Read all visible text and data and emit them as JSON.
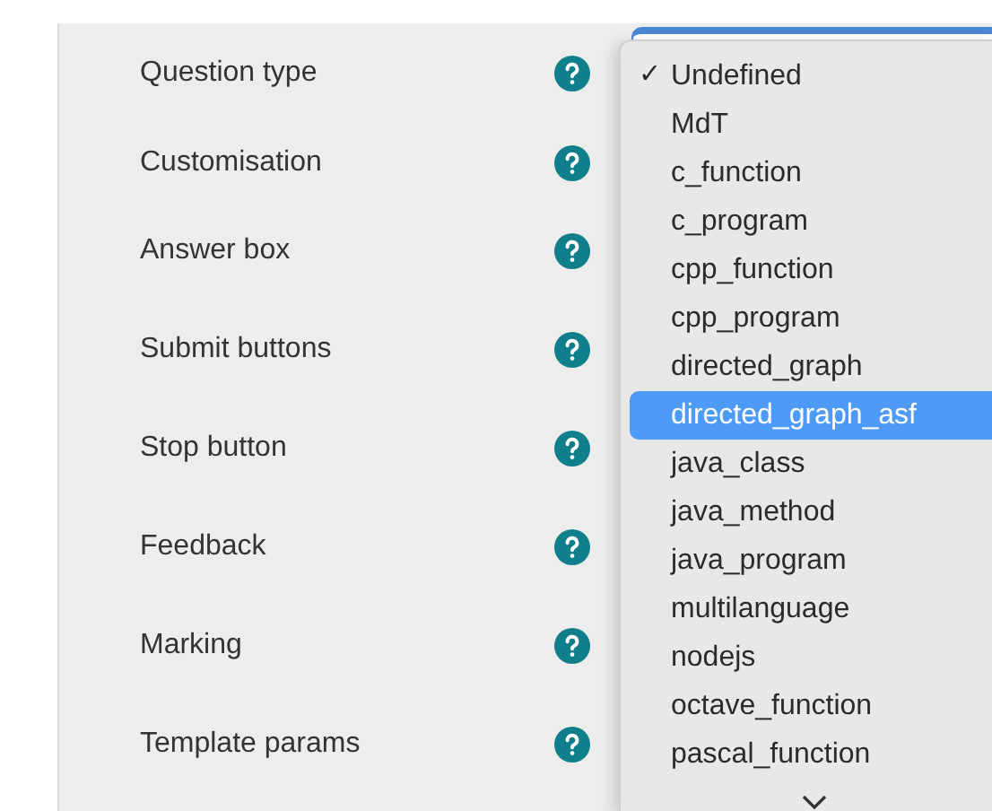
{
  "settings": [
    {
      "label": "Question type"
    },
    {
      "label": "Customisation"
    },
    {
      "label": "Answer box"
    },
    {
      "label": "Submit buttons"
    },
    {
      "label": "Stop button"
    },
    {
      "label": "Feedback"
    },
    {
      "label": "Marking"
    },
    {
      "label": "Template params"
    }
  ],
  "type_menu": {
    "check_mark": "✓",
    "items": [
      {
        "label": "Undefined",
        "checked": true,
        "selected": false
      },
      {
        "label": "MdT",
        "checked": false,
        "selected": false
      },
      {
        "label": "c_function",
        "checked": false,
        "selected": false
      },
      {
        "label": "c_program",
        "checked": false,
        "selected": false
      },
      {
        "label": "cpp_function",
        "checked": false,
        "selected": false
      },
      {
        "label": "cpp_program",
        "checked": false,
        "selected": false
      },
      {
        "label": "directed_graph",
        "checked": false,
        "selected": false
      },
      {
        "label": "directed_graph_asf",
        "checked": false,
        "selected": true
      },
      {
        "label": "java_class",
        "checked": false,
        "selected": false
      },
      {
        "label": "java_method",
        "checked": false,
        "selected": false
      },
      {
        "label": "java_program",
        "checked": false,
        "selected": false
      },
      {
        "label": "multilanguage",
        "checked": false,
        "selected": false
      },
      {
        "label": "nodejs",
        "checked": false,
        "selected": false
      },
      {
        "label": "octave_function",
        "checked": false,
        "selected": false
      },
      {
        "label": "pascal_function",
        "checked": false,
        "selected": false
      }
    ]
  }
}
